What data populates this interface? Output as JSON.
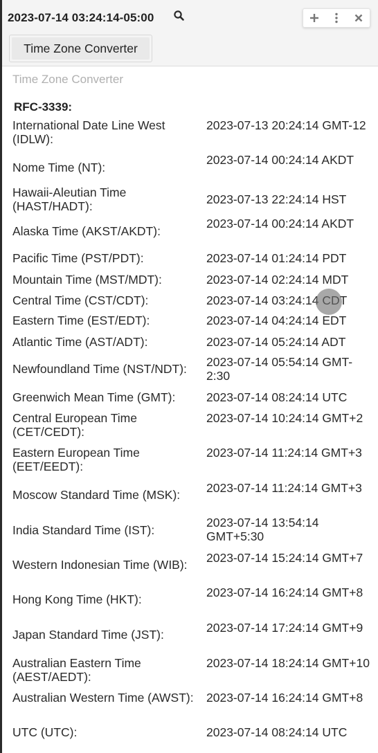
{
  "header": {
    "clock": "2023-07-14 03:24:14-05:00",
    "tab_label": "Time Zone Converter"
  },
  "main": {
    "subtitle": "Time Zone Converter",
    "format_label": "RFC-3339:",
    "rows": [
      {
        "label": "International Date Line West (IDLW):",
        "value": "2023-07-13 20:24:14 GMT-12"
      },
      {
        "label": "Nome Time (NT):",
        "value": "2023-07-14 00:24:14 AKDT"
      },
      {
        "label": "Hawaii-Aleutian Time (HAST/HADT):",
        "value": "2023-07-13 22:24:14 HST"
      },
      {
        "label": "Alaska Time (AKST/AKDT):",
        "value": "2023-07-14 00:24:14 AKDT"
      },
      {
        "label": "Pacific Time (PST/PDT):",
        "value": "2023-07-14 01:24:14 PDT"
      },
      {
        "label": "Mountain Time (MST/MDT):",
        "value": "2023-07-14 02:24:14 MDT"
      },
      {
        "label": "Central Time (CST/CDT):",
        "value": "2023-07-14 03:24:14 CDT"
      },
      {
        "label": "Eastern Time (EST/EDT):",
        "value": "2023-07-14 04:24:14 EDT"
      },
      {
        "label": "Atlantic Time (AST/ADT):",
        "value": "2023-07-14 05:24:14 ADT"
      },
      {
        "label": "Newfoundland Time (NST/NDT):",
        "value": "2023-07-14 05:54:14 GMT-2:30"
      },
      {
        "label": "Greenwich Mean Time (GMT):",
        "value": "2023-07-14 08:24:14 UTC"
      },
      {
        "label": "Central European Time (CET/CEDT):",
        "value": "2023-07-14 10:24:14 GMT+2"
      },
      {
        "label": "Eastern European Time (EET/EEDT):",
        "value": "2023-07-14 11:24:14 GMT+3"
      },
      {
        "label": "Moscow Standard Time (MSK):",
        "value": "2023-07-14 11:24:14 GMT+3"
      },
      {
        "label": "India Standard Time (IST):",
        "value": "2023-07-14 13:54:14 GMT+5:30"
      },
      {
        "label": "Western Indonesian Time (WIB):",
        "value": "2023-07-14 15:24:14 GMT+7"
      },
      {
        "label": "Hong Kong Time (HKT):",
        "value": "2023-07-14 16:24:14 GMT+8"
      },
      {
        "label": "Japan Standard Time (JST):",
        "value": "2023-07-14 17:24:14 GMT+9"
      },
      {
        "label": "Australian Eastern Time (AEST/AEDT):",
        "value": "2023-07-14 18:24:14 GMT+10"
      },
      {
        "label": "Australian Western Time (AWST):",
        "value": "2023-07-14 16:24:14 GMT+8"
      },
      {
        "label": "UTC (UTC):",
        "value": "2023-07-14 08:24:14 UTC"
      }
    ]
  }
}
